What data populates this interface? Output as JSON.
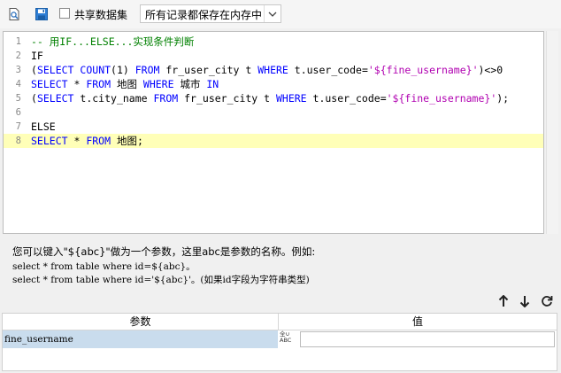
{
  "toolbar": {
    "preview_icon": "search-document-icon",
    "save_icon": "save-icon",
    "shared_dataset_label": "共享数据集",
    "shared_dataset_checked": false,
    "storage_mode": "所有记录都保存在内存中"
  },
  "editor": {
    "lines": [
      {
        "no": "1",
        "tokens": [
          {
            "t": "-- 用",
            "c": "cm"
          },
          {
            "t": "IF",
            "c": "cm"
          },
          {
            "t": "...",
            "c": "cm"
          },
          {
            "t": "ELSE",
            "c": "cm"
          },
          {
            "t": "...实现条件判断",
            "c": "cm"
          }
        ]
      },
      {
        "no": "2",
        "tokens": [
          {
            "t": "IF",
            "c": "pl"
          }
        ]
      },
      {
        "no": "3",
        "tokens": [
          {
            "t": "(",
            "c": "pl"
          },
          {
            "t": "SELECT",
            "c": "kw"
          },
          {
            "t": " ",
            "c": "pl"
          },
          {
            "t": "COUNT",
            "c": "kw"
          },
          {
            "t": "(1) ",
            "c": "pl"
          },
          {
            "t": "FROM",
            "c": "kw"
          },
          {
            "t": " fr_user_city t ",
            "c": "pl"
          },
          {
            "t": "WHERE",
            "c": "kw"
          },
          {
            "t": " t.user_code=",
            "c": "pl"
          },
          {
            "t": "'${fine_username}'",
            "c": "str"
          },
          {
            "t": ")<>0",
            "c": "pl"
          }
        ]
      },
      {
        "no": "4",
        "tokens": [
          {
            "t": "SELECT",
            "c": "kw"
          },
          {
            "t": " * ",
            "c": "pl"
          },
          {
            "t": "FROM",
            "c": "kw"
          },
          {
            "t": " 地图 ",
            "c": "pl"
          },
          {
            "t": "WHERE",
            "c": "kw"
          },
          {
            "t": " 城市 ",
            "c": "pl"
          },
          {
            "t": "IN",
            "c": "kw"
          }
        ]
      },
      {
        "no": "5",
        "tokens": [
          {
            "t": "(",
            "c": "pl"
          },
          {
            "t": "SELECT",
            "c": "kw"
          },
          {
            "t": " t.city_name ",
            "c": "pl"
          },
          {
            "t": "FROM",
            "c": "kw"
          },
          {
            "t": " fr_user_city t ",
            "c": "pl"
          },
          {
            "t": "WHERE",
            "c": "kw"
          },
          {
            "t": " t.user_code=",
            "c": "pl"
          },
          {
            "t": "'${fine_username}'",
            "c": "str"
          },
          {
            "t": ");",
            "c": "pl"
          }
        ]
      },
      {
        "no": "6",
        "tokens": []
      },
      {
        "no": "7",
        "tokens": [
          {
            "t": "ELSE",
            "c": "pl"
          }
        ]
      },
      {
        "no": "8",
        "tokens": [
          {
            "t": "SELECT",
            "c": "kw"
          },
          {
            "t": " * ",
            "c": "pl"
          },
          {
            "t": "FROM",
            "c": "kw"
          },
          {
            "t": " 地图;",
            "c": "pl"
          }
        ]
      }
    ],
    "highlighted_line": "8"
  },
  "help": {
    "line1": "您可以键入\"${abc}\"做为一个参数，这里abc是参数的名称。例如:",
    "line2": "select * from table where id=${abc}。",
    "line3": "select * from table where id='${abc}'。(如果id字段为字符串类型)"
  },
  "param_toolbar": {
    "move_up_icon": "arrow-up-icon",
    "move_down_icon": "arrow-down-icon",
    "refresh_icon": "refresh-icon"
  },
  "params_table": {
    "col_param": "参数",
    "col_value": "值",
    "rows": [
      {
        "name": "fine_username",
        "type_icon_top": "全∪",
        "type_icon_bottom": "ABC",
        "value": ""
      }
    ]
  }
}
